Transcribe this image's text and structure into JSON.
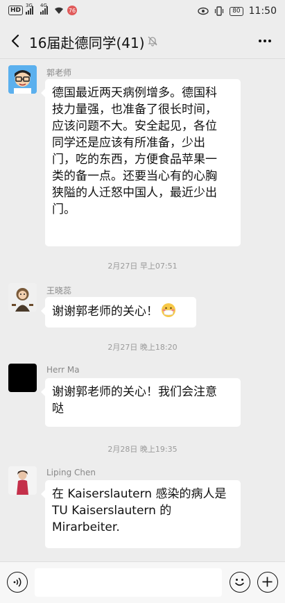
{
  "status_bar": {
    "hd_label": "HD",
    "signal1_label": "3G",
    "signal2_label": "4G",
    "notification_count": "76",
    "battery_level": "80",
    "time": "11:50"
  },
  "header": {
    "title": "16届赴德同学(41)",
    "back_icon": "chevron-left-icon",
    "mute_icon": "bell-off-icon",
    "more_icon": "more-dots-icon"
  },
  "messages": [
    {
      "sender": "郭老师",
      "lines": [
        "德国最近两天病例增多。德国科",
        "技力量强，也准备了很长时间，",
        "应该问题不大。安全起见，各位",
        "同学还是应该有所准备，少出",
        "门，吃的东西，方便食品苹果一",
        "类的备一点。还要当心有的心胸",
        "狭隘的人迁怒中国人，最近少出",
        "门。"
      ]
    },
    {
      "timestamp": "2月27日 早上07:51"
    },
    {
      "sender": "王晓蕊",
      "text": "谢谢郭老师的关心！",
      "emoji": "mask-face-emoji"
    },
    {
      "timestamp": "2月27日 晚上18:20"
    },
    {
      "sender": "Herr Ma",
      "lines": [
        "谢谢郭老师的关心！我们会注意",
        "哒"
      ]
    },
    {
      "timestamp": "2月28日 晚上19:35"
    },
    {
      "sender": "Liping Chen",
      "lines": [
        "在 Kaiserslautern 感染的病人是",
        "TU Kaiserslautern 的",
        "Mirarbeiter."
      ]
    }
  ],
  "input_bar": {
    "value": "",
    "voice_icon": "voice-icon",
    "emoji_icon": "emoji-icon",
    "plus_icon": "plus-icon"
  }
}
